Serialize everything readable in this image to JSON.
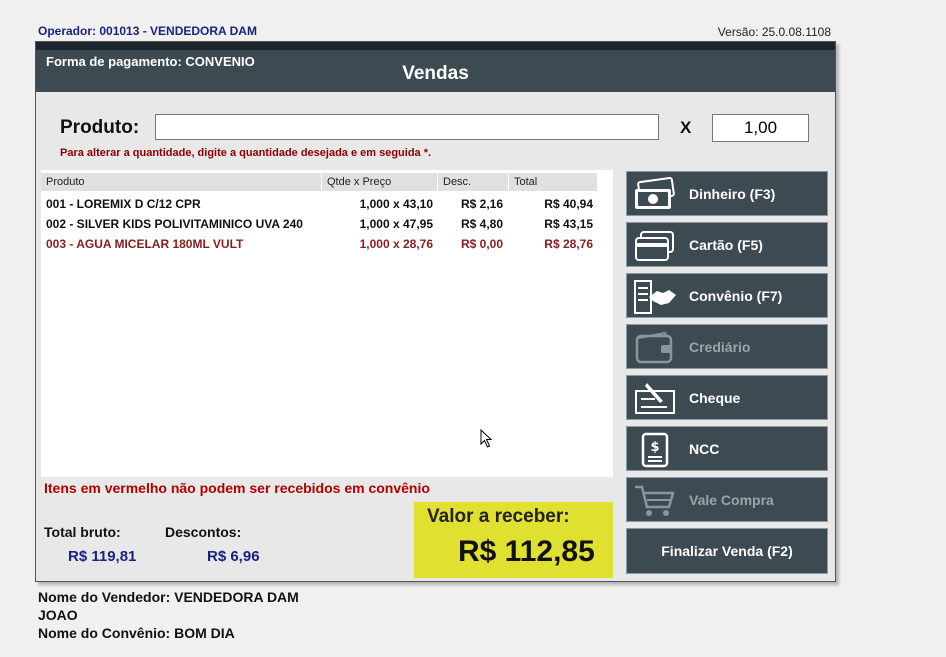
{
  "operator": "Operador: 001013 - VENDEDORA DAM",
  "version": "Versão: 25.0.08.1108",
  "header": {
    "payment_form": "Forma de pagamento: CONVENIO",
    "title": "Vendas"
  },
  "product": {
    "label": "Produto:",
    "value": "",
    "x_label": "X",
    "quantity": "1,00",
    "hint": "Para alterar a quantidade, digite a quantidade desejada e em seguida *."
  },
  "table": {
    "headers": [
      "Produto",
      "Qtde x Preço",
      "Desc.",
      "Total"
    ],
    "rows": [
      {
        "product": "001 - LOREMIX D C/12 CPR",
        "qty_price": "1,000 x 43,10",
        "discount": "R$ 2,16",
        "total": "R$ 40,94",
        "highlight": false
      },
      {
        "product": "002 - SILVER KIDS POLIVITAMINICO UVA 240",
        "qty_price": "1,000 x 47,95",
        "discount": "R$ 4,80",
        "total": "R$ 43,15",
        "highlight": false
      },
      {
        "product": "003 - AGUA MICELAR 180ML VULT",
        "qty_price": "1,000 x 28,76",
        "discount": "R$ 0,00",
        "total": "R$ 28,76",
        "highlight": true
      }
    ]
  },
  "warning": "Itens em vermelho não podem ser recebidos em convênio",
  "totals": {
    "gross_label": "Total bruto:",
    "gross_value": "R$ 119,81",
    "discount_label": "Descontos:",
    "discount_value": "R$ 6,96",
    "receive_label": "Valor a receber:",
    "receive_value": "R$ 112,85"
  },
  "payment_buttons": [
    {
      "label": "Dinheiro (F3)",
      "icon": "cash-icon",
      "enabled": true
    },
    {
      "label": "Cartão (F5)",
      "icon": "credit-card-icon",
      "enabled": true
    },
    {
      "label": "Convênio (F7)",
      "icon": "handshake-icon",
      "enabled": true
    },
    {
      "label": "Crediário",
      "icon": "wallet-icon",
      "enabled": false
    },
    {
      "label": "Cheque",
      "icon": "check-icon",
      "enabled": true
    },
    {
      "label": "NCC",
      "icon": "receipt-icon",
      "enabled": true
    },
    {
      "label": "Vale Compra",
      "icon": "shopping-cart-icon",
      "enabled": false
    }
  ],
  "finalize_label": "Finalizar Venda (F2)",
  "footer": {
    "seller": "Nome do Vendedor: VENDEDORA DAM",
    "customer": "JOAO",
    "agreement": "Nome do Convênio: BOM DIA"
  }
}
